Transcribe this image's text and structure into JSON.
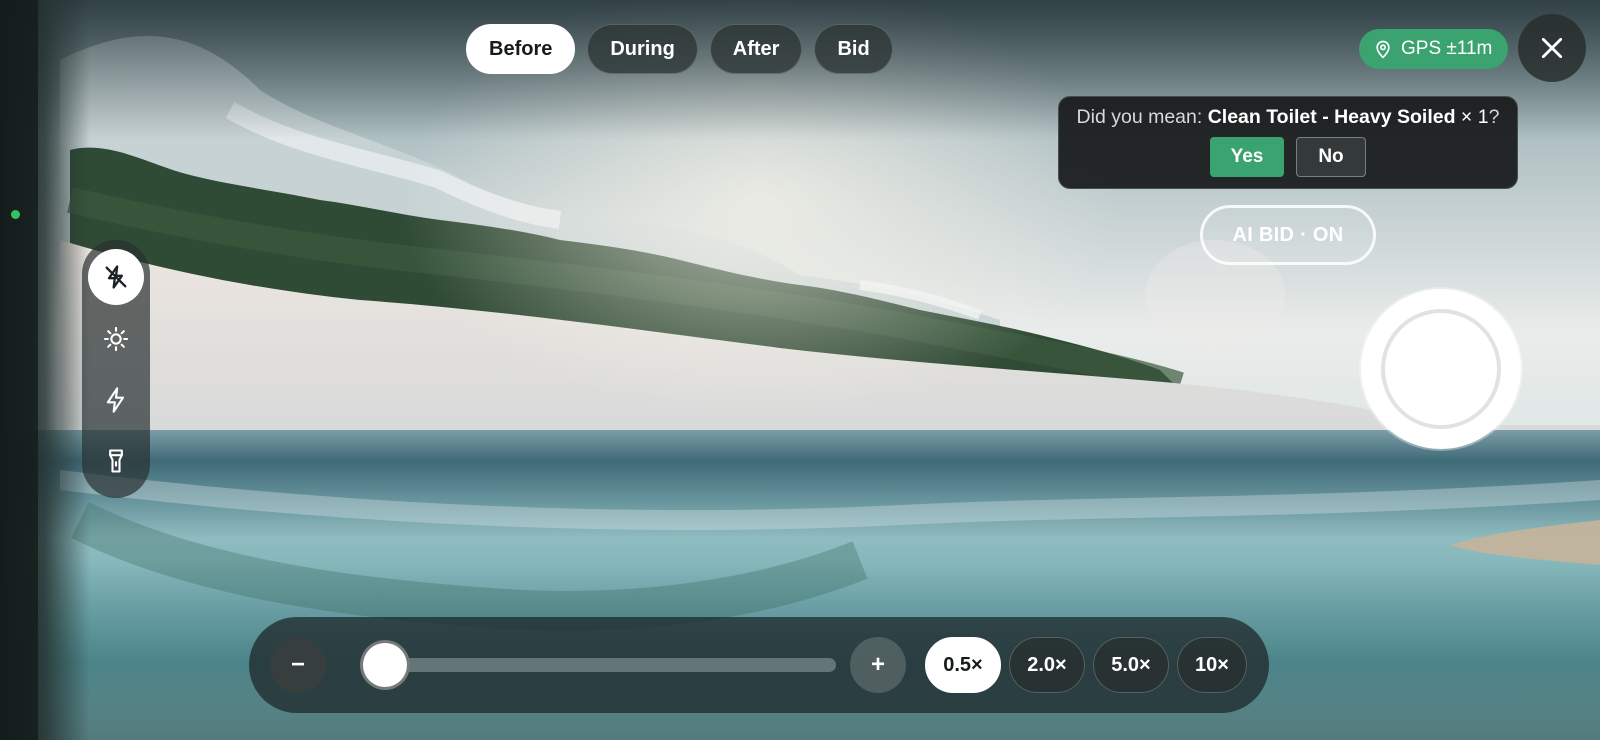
{
  "tabs": [
    {
      "label": "Before",
      "active": true
    },
    {
      "label": "During",
      "active": false
    },
    {
      "label": "After",
      "active": false
    },
    {
      "label": "Bid",
      "active": false
    }
  ],
  "gps": {
    "label": "GPS ±11m",
    "icon": "location-pin-icon",
    "color": "#3aa36f"
  },
  "close": {
    "icon": "close-icon"
  },
  "suggestion": {
    "prefix": "Did you mean: ",
    "item": "Clean Toilet - Heavy Soiled",
    "quantity": " × 1",
    "suffix": "?",
    "yes_label": "Yes",
    "no_label": "No"
  },
  "ai_bid": {
    "label": "AI BID · ON",
    "enabled": true
  },
  "shutter": {
    "icon": "shutter-button"
  },
  "tool_rail": [
    {
      "icon": "flash-off-icon",
      "active": true
    },
    {
      "icon": "brightness-icon",
      "active": false
    },
    {
      "icon": "flash-icon",
      "active": false
    },
    {
      "icon": "flashlight-icon",
      "active": false
    }
  ],
  "zoom": {
    "minus_label": "−",
    "plus_label": "+",
    "slider_fraction": 0.05,
    "presets": [
      {
        "label": "0.5×",
        "active": true
      },
      {
        "label": "2.0×",
        "active": false
      },
      {
        "label": "5.0×",
        "active": false
      },
      {
        "label": "10×",
        "active": false
      }
    ]
  },
  "colors": {
    "accent": "#3aa36f",
    "surface": "#1e2628"
  }
}
